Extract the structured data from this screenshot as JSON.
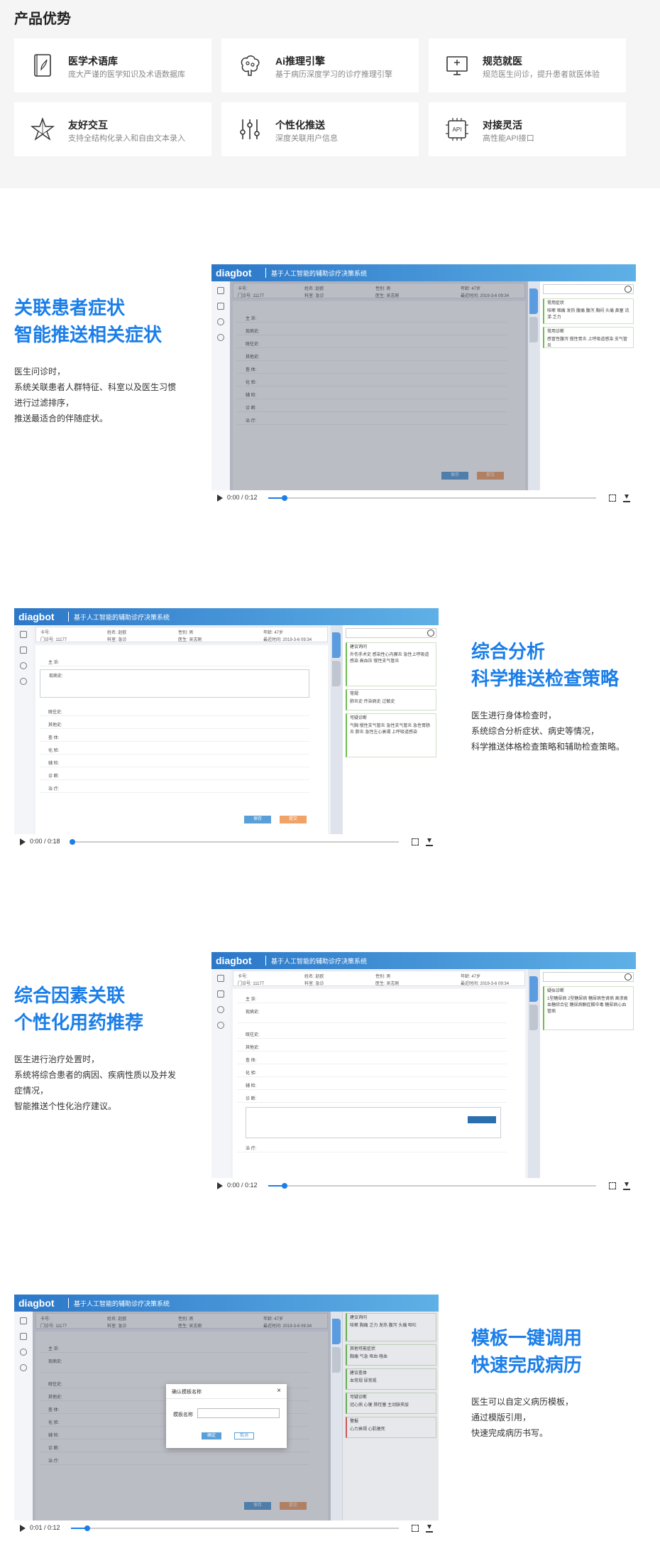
{
  "advantages": {
    "title": "产品优势",
    "cards": [
      {
        "title": "医学术语库",
        "desc": "庞大严谨的医学知识及术语数据库",
        "icon": "book-icon"
      },
      {
        "title": "Ai推理引擎",
        "desc": "基于病历深度学习的诊疗推理引擎",
        "icon": "brain-icon"
      },
      {
        "title": "规范就医",
        "desc": "规范医生问诊，提升患者就医体验",
        "icon": "monitor-icon"
      },
      {
        "title": "友好交互",
        "desc": "支持全结构化录入和自由文本录入",
        "icon": "star-network-icon"
      },
      {
        "title": "个性化推送",
        "desc": "深度关联用户信息",
        "icon": "sliders-icon"
      },
      {
        "title": "对接灵活",
        "desc": "高性能API接口",
        "icon": "api-chip-icon",
        "icon_text": "API"
      }
    ]
  },
  "app": {
    "logo": "diagbot",
    "title": "基于人工智能的辅助诊疗决策系统"
  },
  "features": [
    {
      "title_line1": "关联患者症状",
      "title_line2": "智能推送相关症状",
      "desc": [
        "医生问诊时，",
        "系统关联患者人群特征、科室以及医生习惯",
        "进行过滤排序，",
        "推送最适合的伴随症状。"
      ],
      "video_time": "0:00 / 0:12",
      "progress": 0.05
    },
    {
      "title_line1": "综合分析",
      "title_line2": "科学推送检查策略",
      "desc": [
        "医生进行身体检查时，",
        "系统综合分析症状、病史等情况，",
        "科学推送体格检查策略和辅助检查策略。"
      ],
      "video_time": "0:00 / 0:18",
      "progress": 0.0
    },
    {
      "title_line1": "综合因素关联",
      "title_line2": "个性化用药推荐",
      "desc": [
        "医生进行治疗处置时，",
        "系统将综合患者的病因、疾病性质以及并发",
        "症情况，",
        "智能推送个性化治疗建议。"
      ],
      "video_time": "0:00 / 0:12",
      "progress": 0.05
    },
    {
      "title_line1": "模板一键调用",
      "title_line2": "快速完成病历",
      "desc": [
        "医生可以自定义病历模板，",
        "通过模版引用，",
        "快速完成病历书写。"
      ],
      "video_time": "0:01 / 0:12",
      "progress": 0.05
    }
  ],
  "form": {
    "patient": {
      "card": "卡号:",
      "name": "姓名: 赵欧",
      "sex": "性别: 男",
      "age": "年龄: 47岁",
      "outpatient": "门诊号: 11177",
      "dept": "科室: 急诊",
      "doctor": "医生: 吴志刚",
      "time": "最近时间: 2019-3-6 09:34"
    },
    "rows": [
      "主 诉:",
      "现病史:",
      "既往史:",
      "其他史:",
      "查 体:",
      "化 验:",
      "辅 检:",
      "诊 断:",
      "治 疗:"
    ],
    "save": "保存",
    "submit": "提交"
  },
  "right_panels": {
    "v1": [
      {
        "title": "常用症状",
        "text": "咳嗽 咽痛 发热 腹痛 腹泻 胸闷 头痛 鼻塞 流涕 乏力"
      },
      {
        "title": "常用诊断",
        "text": "感冒性腹泻 慢性胃炎 上呼吸道感染 支气管炎"
      }
    ],
    "v2": [
      {
        "title": "建议询问",
        "text": "外伤手术史 感染性心内膜炎 急性上呼吸道感染 高血压 慢性支气管炎"
      },
      {
        "title": "常规",
        "text": "肺炎史 传染病史 过敏史"
      },
      {
        "title": "可疑诊断",
        "text": "气胸 慢性支气管炎 急性支气管炎 急性胃肠炎 肺炎 急性左心衰竭 上呼吸道感染"
      }
    ],
    "v3": [
      {
        "title": "疑似诊断",
        "text": "1型糖尿病 2型糖尿病 糖尿病性肾病 高渗高血糖综合征 糖尿病酮症酸中毒 糖尿病心血管病"
      }
    ],
    "v4": [
      {
        "title": "建议询问",
        "text": "咳嗽 胸痛 乏力 发热 腹泻 头痛 呕吐"
      },
      {
        "title": "其他可能症状",
        "text": "胸痛 气急 呕血 咯血"
      },
      {
        "title": "建议查体",
        "text": "血常规 尿常规"
      },
      {
        "title": "可疑诊断",
        "text": "冠心病 心梗 肺栓塞 主动脉夹层"
      },
      {
        "title": "警报",
        "text": "心力衰竭 心肌梗死"
      }
    ]
  },
  "modal": {
    "title": "确认模板名称",
    "label": "模板名称",
    "ok": "确定",
    "cancel": "取消"
  },
  "colors": {
    "accent": "#1b7ee8",
    "save": "#5a9fd8",
    "submit": "#f0a267"
  }
}
